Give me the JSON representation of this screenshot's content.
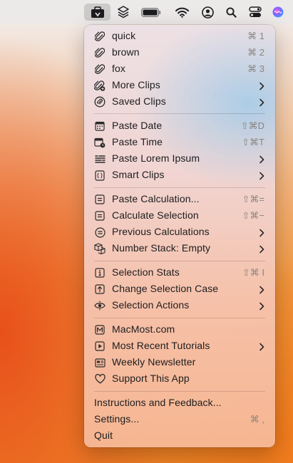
{
  "menubar": {
    "icons": [
      "clipboard-toolbox-icon",
      "layers-icon",
      "battery-icon",
      "wifi-icon",
      "user-account-icon",
      "search-icon",
      "control-center-icon",
      "siri-icon"
    ]
  },
  "menu": {
    "clips": [
      {
        "label": "quick",
        "shortcut": "⌘ 1"
      },
      {
        "label": "brown",
        "shortcut": "⌘ 2"
      },
      {
        "label": "fox",
        "shortcut": "⌘ 3"
      },
      {
        "label": "More Clips"
      },
      {
        "label": "Saved Clips"
      }
    ],
    "paste": [
      {
        "label": "Paste Date",
        "shortcut": "⇧⌘D"
      },
      {
        "label": "Paste Time",
        "shortcut": "⇧⌘T"
      },
      {
        "label": "Paste Lorem Ipsum"
      },
      {
        "label": "Smart Clips"
      }
    ],
    "calc": [
      {
        "label": "Paste Calculation...",
        "shortcut": "⇧⌘="
      },
      {
        "label": "Calculate Selection",
        "shortcut": "⇧⌘−"
      },
      {
        "label": "Previous Calculations"
      },
      {
        "label": "Number Stack: Empty"
      }
    ],
    "selection": [
      {
        "label": "Selection Stats",
        "shortcut": "⇧⌘ I"
      },
      {
        "label": "Change Selection Case"
      },
      {
        "label": "Selection Actions"
      }
    ],
    "macmost": [
      {
        "label": "MacMost.com"
      },
      {
        "label": "Most Recent Tutorials"
      },
      {
        "label": "Weekly Newsletter"
      },
      {
        "label": "Support This App"
      }
    ],
    "footer": [
      {
        "label": "Instructions and Feedback..."
      },
      {
        "label": "Settings...",
        "shortcut": "⌘ ,"
      },
      {
        "label": "Quit"
      }
    ]
  }
}
